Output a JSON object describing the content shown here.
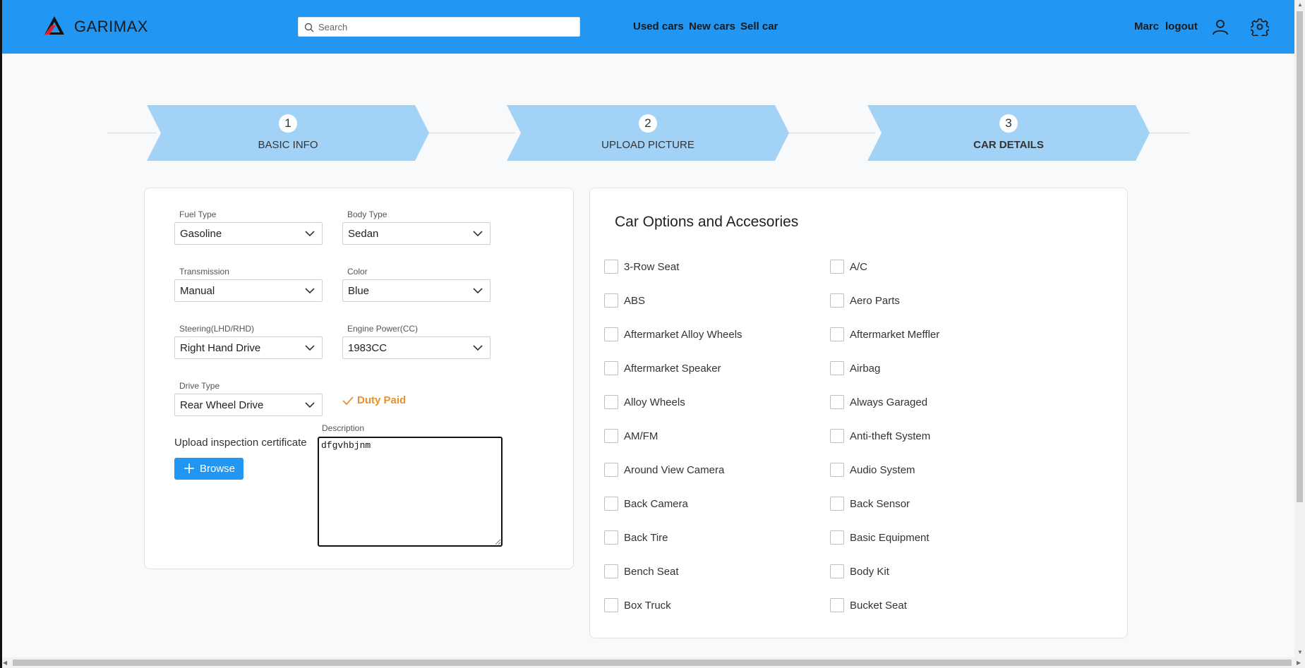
{
  "header": {
    "brand": "GARIMAX",
    "search_placeholder": "Search",
    "nav": [
      "Used cars",
      "New cars",
      "Sell car"
    ],
    "user_name": "Marc",
    "logout": "logout",
    "accent_color": "#2196f3"
  },
  "steps": [
    {
      "number": "1",
      "label": "BASIC INFO"
    },
    {
      "number": "2",
      "label": "UPLOAD PICTURE"
    },
    {
      "number": "3",
      "label": "CAR DETAILS",
      "active": true
    }
  ],
  "form": {
    "fuel_type": {
      "label": "Fuel Type",
      "value": "Gasoline"
    },
    "body_type": {
      "label": "Body Type",
      "value": "Sedan"
    },
    "transmission": {
      "label": "Transmission",
      "value": "Manual"
    },
    "color": {
      "label": "Color",
      "value": "Blue"
    },
    "steering": {
      "label": "Steering(LHD/RHD)",
      "value": "Right Hand Drive"
    },
    "engine_power": {
      "label": "Engine Power(CC)",
      "value": "1983CC"
    },
    "drive_type": {
      "label": "Drive Type",
      "value": "Rear Wheel Drive"
    },
    "duty_paid": "Duty Paid",
    "upload_label": "Upload inspection certificate",
    "browse": "Browse",
    "description_label": "Description",
    "description_value": "dfgvhbjnm"
  },
  "options": {
    "title": "Car Options and Accesories",
    "left": [
      "3-Row Seat",
      "ABS",
      "Aftermarket Alloy Wheels",
      "Aftermarket Speaker",
      "Alloy Wheels",
      "AM/FM",
      "Around View Camera",
      "Back Camera",
      "Back Tire",
      "Bench Seat",
      "Box Truck"
    ],
    "right": [
      "A/C",
      "Aero Parts",
      "Aftermarket Meffler",
      "Airbag",
      "Always Garaged",
      "Anti-theft System",
      "Audio System",
      "Back Sensor",
      "Basic Equipment",
      "Body Kit",
      "Bucket Seat"
    ]
  }
}
